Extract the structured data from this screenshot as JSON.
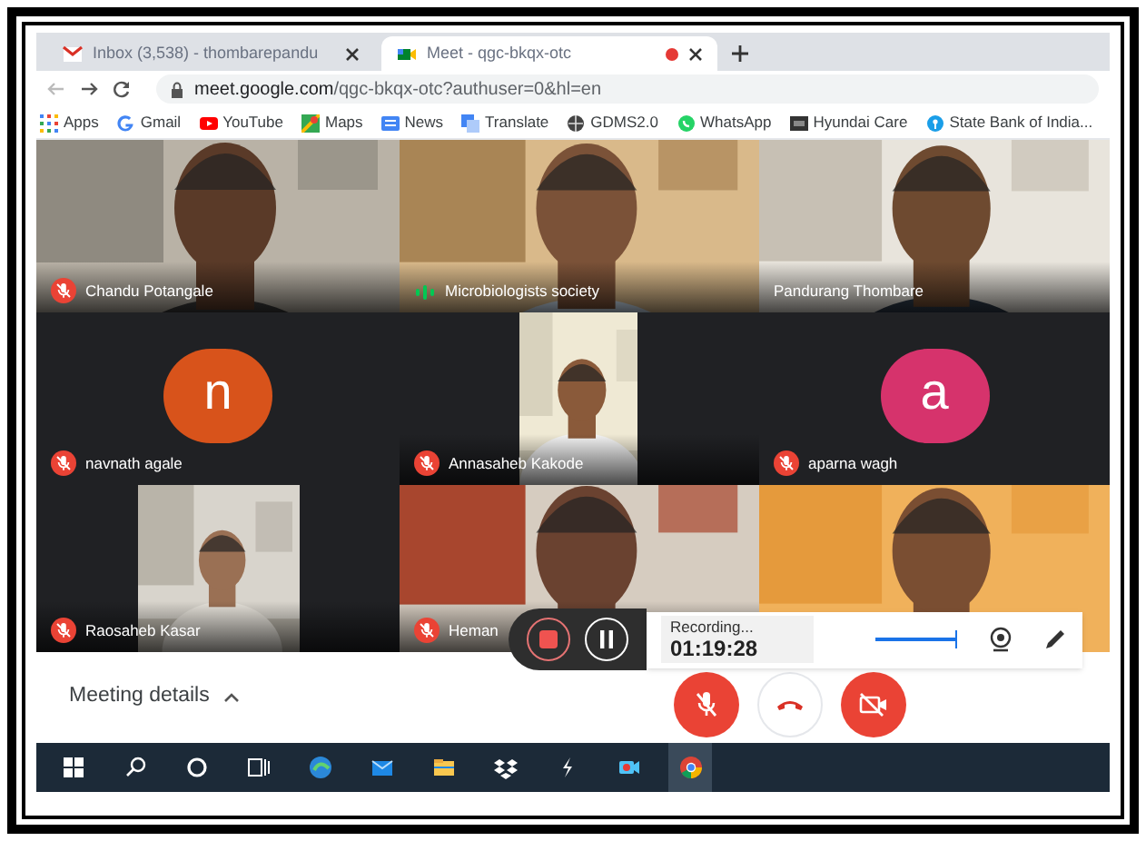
{
  "browser": {
    "tabs": [
      {
        "title": "Inbox (3,538) - thombarepandu",
        "kind": "mail",
        "selected": false,
        "recording": false
      },
      {
        "title": "Meet - qgc-bkqx-otc",
        "kind": "meet",
        "selected": true,
        "recording": true
      }
    ],
    "url_host": "meet.google.com",
    "url_path": "/qgc-bkqx-otc?authuser=0&hl=en",
    "bookmarks": [
      {
        "title": "Apps",
        "kind": "apps"
      },
      {
        "title": "Gmail",
        "kind": "google"
      },
      {
        "title": "YouTube",
        "kind": "youtube"
      },
      {
        "title": "Maps",
        "kind": "maps"
      },
      {
        "title": "News",
        "kind": "news"
      },
      {
        "title": "Translate",
        "kind": "translate"
      },
      {
        "title": "GDMS2.0",
        "kind": "globe"
      },
      {
        "title": "WhatsApp",
        "kind": "whatsapp"
      },
      {
        "title": "Hyundai Care",
        "kind": "square"
      },
      {
        "title": "State Bank of India...",
        "kind": "bank"
      }
    ]
  },
  "tiles": [
    {
      "kind": "video",
      "name": "Chandu Potangale",
      "muted": true,
      "speaking": false
    },
    {
      "kind": "video",
      "name": "Microbiologists society",
      "muted": false,
      "speaking": true
    },
    {
      "kind": "video",
      "name": "Pandurang Thombare",
      "muted": false,
      "speaking": false
    },
    {
      "kind": "avatar",
      "name": "navnath agale",
      "muted": true,
      "speaking": false,
      "letter": "n",
      "color": "#d8531b"
    },
    {
      "kind": "portrait",
      "name": "Annasaheb Kakode",
      "muted": true,
      "speaking": false
    },
    {
      "kind": "avatar",
      "name": "aparna wagh",
      "muted": true,
      "speaking": false,
      "letter": "a",
      "color": "#d6336c"
    },
    {
      "kind": "portrait",
      "name": "Raosaheb Kasar",
      "muted": true,
      "speaking": false
    },
    {
      "kind": "video",
      "name": "Heman",
      "muted": true,
      "speaking": false
    },
    {
      "kind": "video"
    }
  ],
  "recorder": {
    "label": "Recording...",
    "time": "01:19:28",
    "level": 0.95
  },
  "meeting_details": "Meeting details",
  "controls": {
    "mic_on": false,
    "camera_on": false
  }
}
